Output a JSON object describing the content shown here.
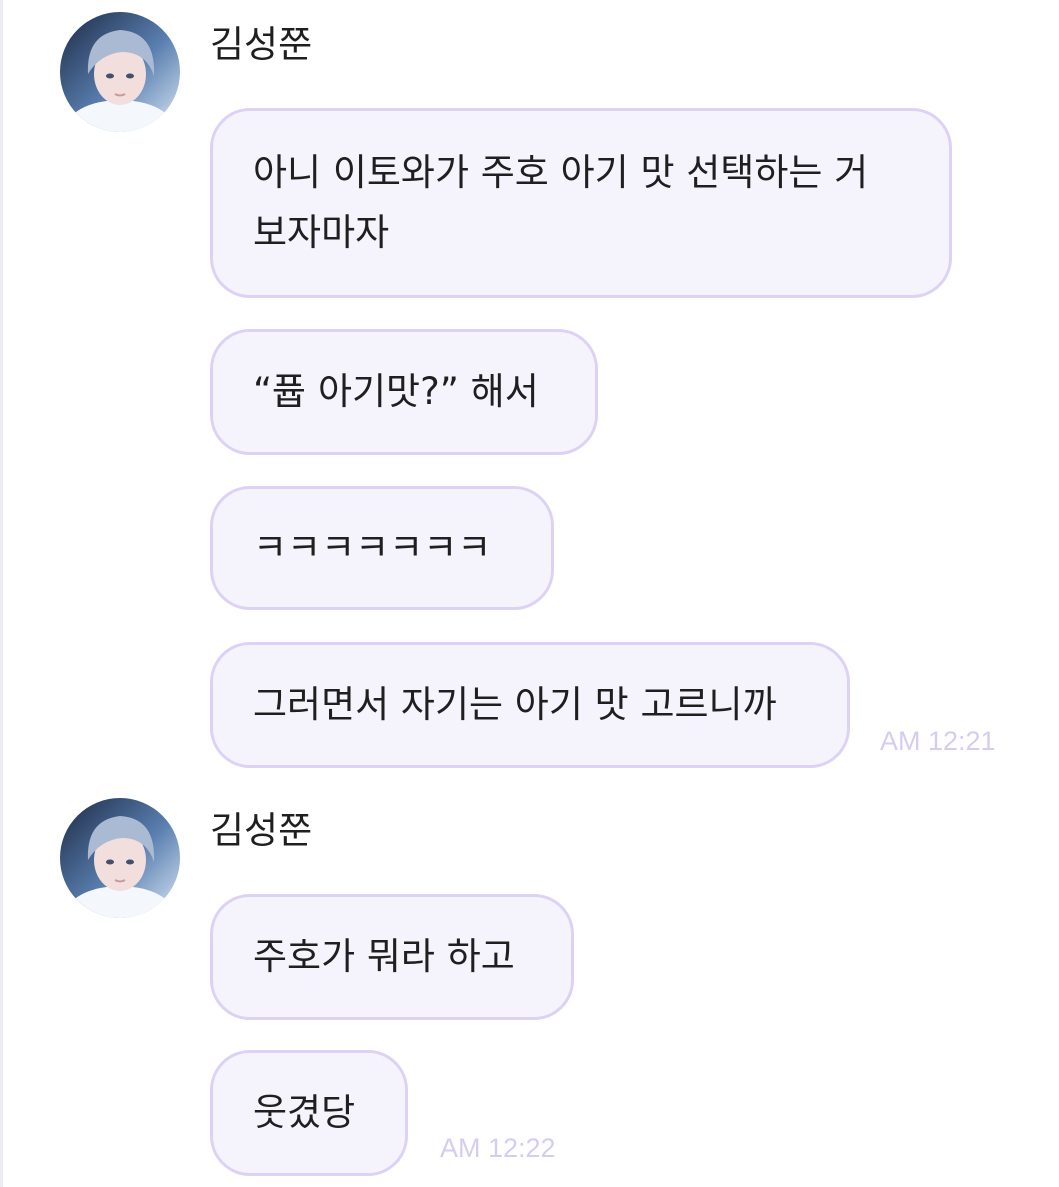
{
  "groups": [
    {
      "sender": "김성쭌",
      "avatar": "avatar-photo",
      "messages": [
        "아니 이토와가 주호 아기 맛 선택하는 거\n보자마자",
        "“퓹 아기맛?” 해서",
        "ㅋㅋㅋㅋㅋㅋㅋ",
        "그러면서 자기는 아기 맛 고르니까"
      ],
      "time": "AM 12:21"
    },
    {
      "sender": "김성쭌",
      "avatar": "avatar-photo",
      "messages": [
        "주호가 뭐라 하고",
        "웃겼당"
      ],
      "time": "AM 12:22"
    }
  ],
  "colors": {
    "bubble_bg": "#f5f4fd",
    "bubble_border": "#ddd2f4",
    "timestamp": "#d6ccf0"
  }
}
